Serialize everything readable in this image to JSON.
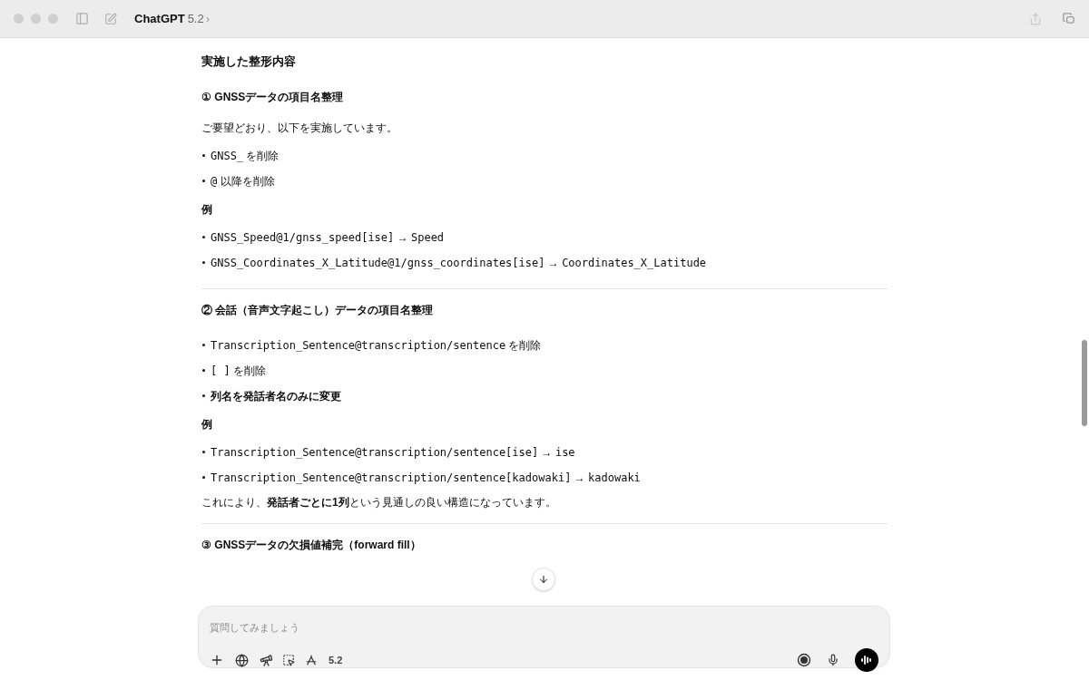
{
  "window": {
    "title": "ChatGPT",
    "model": "5.2",
    "chevron": "›"
  },
  "content": [
    {
      "kind": "heading",
      "text": "実施した整形内容"
    },
    {
      "kind": "subheading",
      "text": "① GNSSデータの項目名整理"
    },
    {
      "kind": "paragraph",
      "text": "ご要望どおり、以下を実施しています。"
    },
    {
      "kind": "bullet",
      "parts": [
        {
          "kind": "code",
          "text": "GNSS_"
        },
        {
          "kind": "plain",
          "text": " を削除"
        }
      ]
    },
    {
      "kind": "bullet",
      "parts": [
        {
          "kind": "code",
          "text": "@"
        },
        {
          "kind": "plain",
          "text": " 以降を削除"
        }
      ]
    },
    {
      "kind": "label",
      "text": "例"
    },
    {
      "kind": "bullet",
      "parts": [
        {
          "kind": "code",
          "text": "GNSS_Speed@1/gnss_speed[ise]"
        },
        {
          "kind": "plain",
          "text": " → "
        },
        {
          "kind": "code",
          "text": "Speed"
        }
      ]
    },
    {
      "kind": "bullet",
      "parts": [
        {
          "kind": "code",
          "text": "GNSS_Coordinates_X_Latitude@1/gnss_coordinates[ise]"
        },
        {
          "kind": "plain",
          "text": " → "
        },
        {
          "kind": "code",
          "text": "Coordinates_X_Latitude"
        }
      ]
    },
    {
      "kind": "divider"
    },
    {
      "kind": "subheading",
      "text": "② 会話（音声文字起こし）データの項目名整理"
    },
    {
      "kind": "bullet",
      "parts": [
        {
          "kind": "code",
          "text": "Transcription_Sentence@transcription/sentence"
        },
        {
          "kind": "plain",
          "text": " を削除"
        }
      ]
    },
    {
      "kind": "bullet",
      "parts": [
        {
          "kind": "code",
          "text": "[ ]"
        },
        {
          "kind": "plain",
          "text": " を削除"
        }
      ]
    },
    {
      "kind": "bullet",
      "parts": [
        {
          "kind": "bold",
          "text": "列名を発話者名のみに変更"
        }
      ]
    },
    {
      "kind": "label",
      "text": "例"
    },
    {
      "kind": "bullet",
      "parts": [
        {
          "kind": "code",
          "text": "Transcription_Sentence@transcription/sentence[ise]"
        },
        {
          "kind": "plain",
          "text": " → "
        },
        {
          "kind": "code",
          "text": "ise"
        }
      ]
    },
    {
      "kind": "bullet",
      "parts": [
        {
          "kind": "code",
          "text": "Transcription_Sentence@transcription/sentence[kadowaki]"
        },
        {
          "kind": "plain",
          "text": " → "
        },
        {
          "kind": "code",
          "text": "kadowaki"
        }
      ]
    },
    {
      "kind": "paragraph",
      "text": "これにより、**発話者ごとに1列**という見通しの良い構造になっています。"
    },
    {
      "kind": "divider"
    },
    {
      "kind": "subheading",
      "text": "③ GNSSデータの欠損値補完（forward fill）"
    }
  ],
  "composer": {
    "placeholder": "質問してみましょう",
    "model": "5.2"
  }
}
